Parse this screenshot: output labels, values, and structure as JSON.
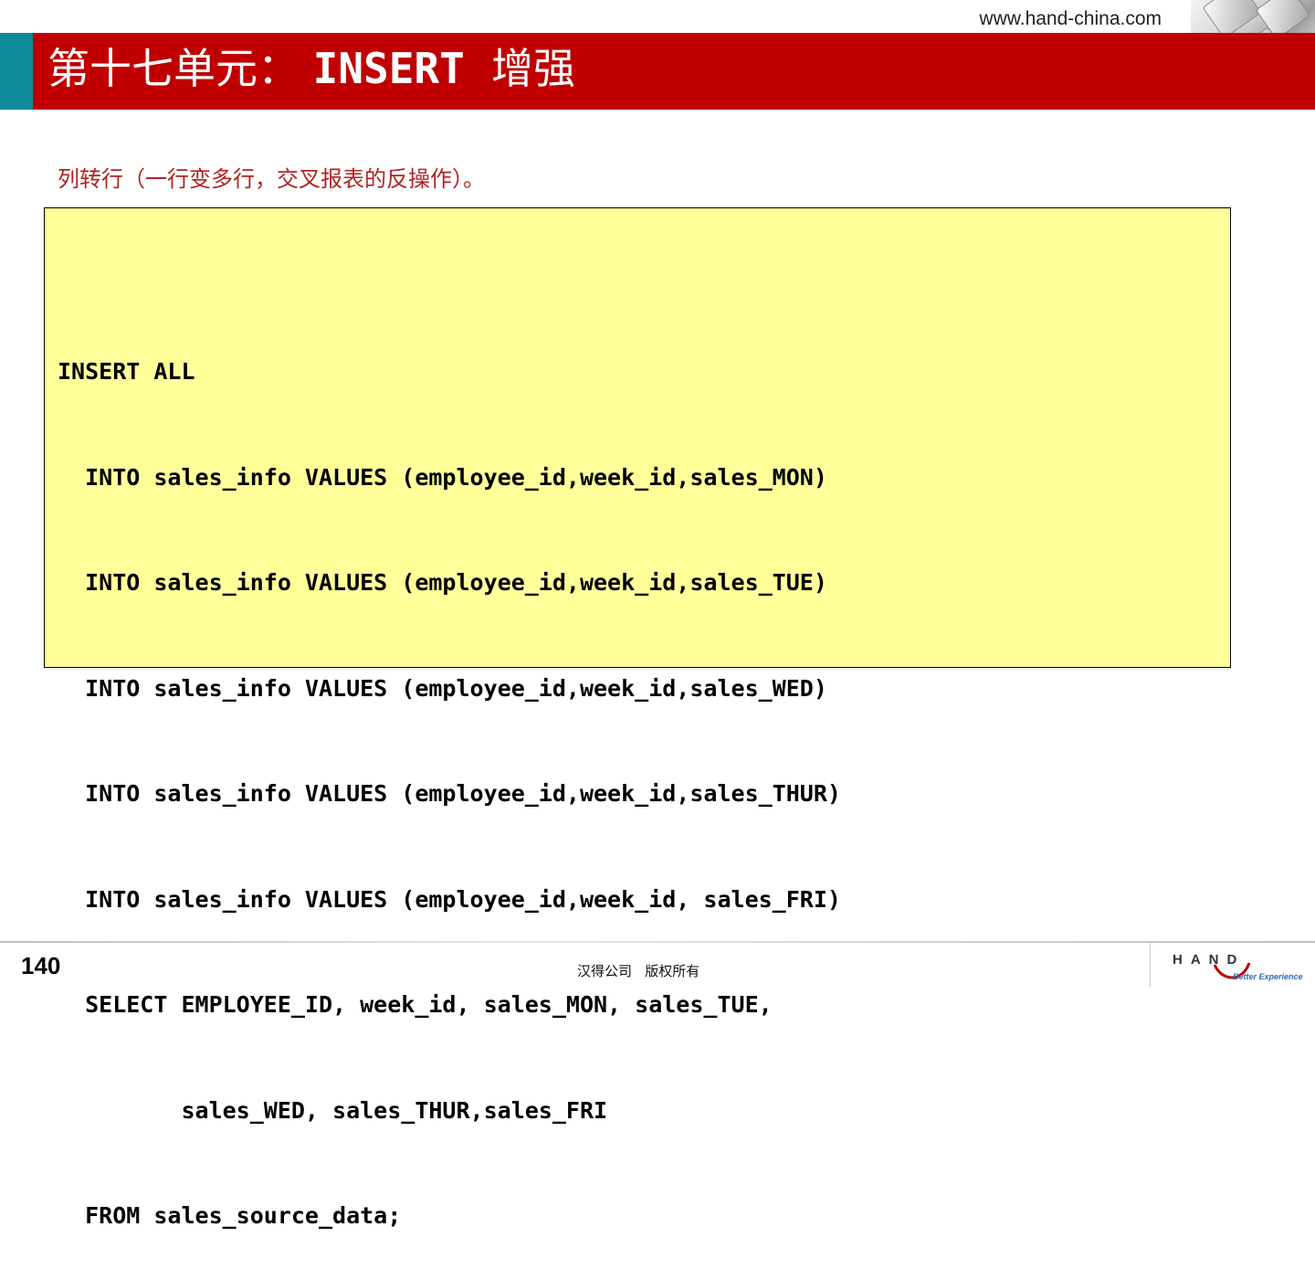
{
  "header": {
    "url": "www.hand-china.com",
    "title_prefix": "第十七单元：",
    "title_keyword": "INSERT",
    "title_suffix": "增强",
    "corner_image": "keyboard-photo"
  },
  "content": {
    "subtitle": "列转行（一行变多行，交叉报表的反操作）。",
    "code_lines": [
      "INSERT ALL",
      "  INTO sales_info VALUES (employee_id,week_id,sales_MON)",
      "  INTO sales_info VALUES (employee_id,week_id,sales_TUE)",
      "  INTO sales_info VALUES (employee_id,week_id,sales_WED)",
      "  INTO sales_info VALUES (employee_id,week_id,sales_THUR)",
      "  INTO sales_info VALUES (employee_id,week_id, sales_FRI)",
      "  SELECT EMPLOYEE_ID, week_id, sales_MON, sales_TUE,",
      "         sales_WED, sales_THUR,sales_FRI",
      "  FROM sales_source_data;"
    ]
  },
  "footer": {
    "page_number": "140",
    "copyright": "汉得公司   版权所有",
    "logo_text": "HAND",
    "logo_tagline": "Better Experience"
  },
  "colors": {
    "title_bar": "#c00000",
    "title_accent": "#0e8a9a",
    "subtitle": "#b22222",
    "code_background": "#ffff99"
  }
}
